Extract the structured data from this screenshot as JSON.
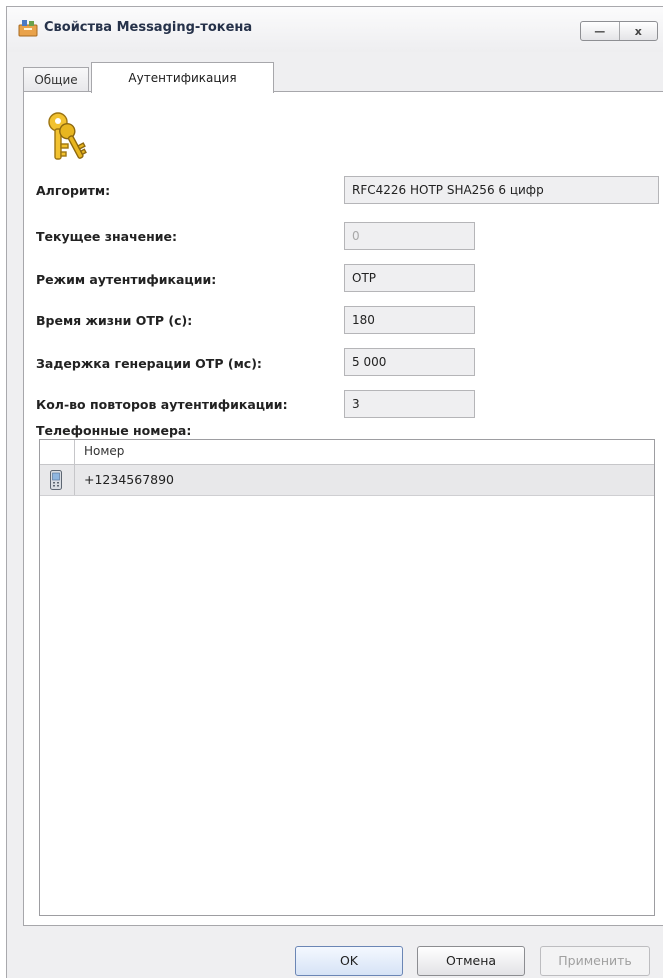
{
  "window": {
    "title": "Свойства Messaging-токена",
    "minimize_glyph": "—",
    "close_glyph": "x"
  },
  "tabs": [
    {
      "label": "Общие",
      "active": false
    },
    {
      "label": "Аутентификация",
      "active": true
    }
  ],
  "icons": {
    "app": "token-icon",
    "header": "keys-icon",
    "row": "mobile-phone-icon"
  },
  "fields": {
    "algorithm": {
      "label": "Алгоритм:",
      "value": "RFC4226 HOTP SHA256 6 цифр"
    },
    "current_value": {
      "label": "Текущее значение:",
      "value": "0",
      "disabled": true
    },
    "auth_mode": {
      "label": "Режим аутентификации:",
      "value": "OTP"
    },
    "otp_lifetime": {
      "label": "Время жизни OTP (c):",
      "value": "180"
    },
    "otp_delay": {
      "label": "Задержка генерации OTP (мс):",
      "value": "5 000"
    },
    "auth_retries": {
      "label": "Кол-во повторов аутентификации:",
      "value": "3"
    }
  },
  "phones": {
    "label": "Телефонные номера:",
    "column_header": "Номер",
    "rows": [
      "+1234567890"
    ]
  },
  "buttons": {
    "ok": "OK",
    "cancel": "Отмена",
    "apply": "Применить"
  },
  "colors": {
    "window_bg": "#efeff1",
    "title_text": "#26324a",
    "ok_accent": "#6b86b5"
  }
}
